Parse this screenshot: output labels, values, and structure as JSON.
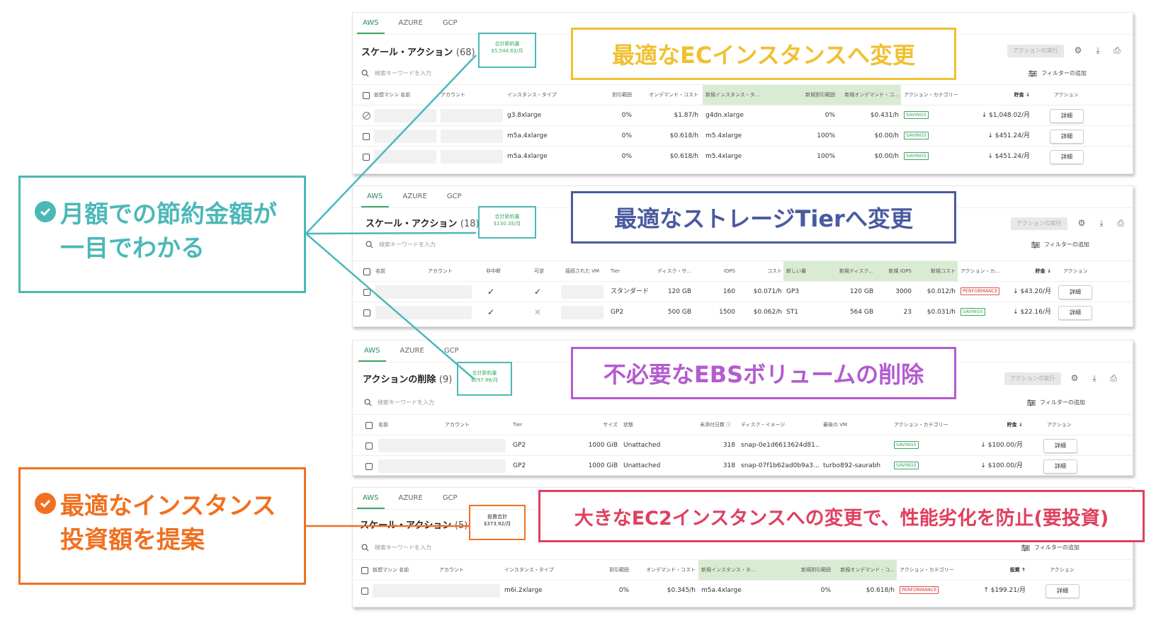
{
  "tab_labels": [
    "AWS",
    "AZURE",
    "GCP"
  ],
  "common": {
    "search_placeholder": "検索キーワードを入力",
    "filter_label": "フィルターの追加",
    "exec_label": "アクションの実行",
    "detail_label": "詳細",
    "savings_label": "SAVINGS",
    "performance_label": "PERFORMANCE"
  },
  "p1": {
    "title": "スケール・アクション",
    "count": "(68)",
    "sum_label": "合計節約量",
    "sum_value": "$5,544.63/月",
    "headers": [
      "仮想マシン 名前",
      "アカウント",
      "インスタンス・タイプ",
      "割引範囲",
      "オンデマンド・コスト",
      "新規インスタンス・タ...",
      "新規割引範囲",
      "新規オンデマンド・コ...",
      "アクション・カテゴリー",
      "貯金",
      "アクション"
    ],
    "rows": [
      {
        "type": "g3.8xlarge",
        "disc": "0%",
        "cost": "$1.87/h",
        "newtype": "g4dn.xlarge",
        "newdisc": "0%",
        "newcost": "$0.431/h",
        "saving": "↓ $1,048.02/月"
      },
      {
        "type": "m5a.4xlarge",
        "disc": "0%",
        "cost": "$0.618/h",
        "newtype": "m5.4xlarge",
        "newdisc": "100%",
        "newcost": "$0.00/h",
        "saving": "↓ $451.24/月"
      },
      {
        "type": "m5a.4xlarge",
        "disc": "0%",
        "cost": "$0.618/h",
        "newtype": "m5.4xlarge",
        "newdisc": "100%",
        "newcost": "$0.00/h",
        "saving": "↓ $451.24/月"
      }
    ],
    "banner": "最適なECインスタンスへ変更"
  },
  "p2": {
    "title": "スケール・アクション",
    "count": "(18)",
    "sum_label": "合計節約量",
    "sum_value": "$130.35/月",
    "headers": [
      "名前",
      "アカウント",
      "非中断",
      "可逆",
      "接続された VM",
      "Tier",
      "ディスク・サ...",
      "IOPS",
      "コスト",
      "新しい層",
      "新規ディスク...",
      "新規 IOPS",
      "新規コスト",
      "アクション・カ...",
      "貯金",
      "アクション"
    ],
    "rows": [
      {
        "tier": "スタンダード",
        "disk": "120 GB",
        "iops": "160",
        "cost": "$0.071/h",
        "newtier": "GP3",
        "newdisk": "120 GB",
        "newiops": "3000",
        "newcost": "$0.012/h",
        "saving": "↓ $43.20/月"
      },
      {
        "tier": "GP2",
        "disk": "500 GB",
        "iops": "1500",
        "cost": "$0.062/h",
        "newtier": "ST1",
        "newdisk": "564 GB",
        "newiops": "23",
        "newcost": "$0.031/h",
        "saving": "↓ $22.16/月"
      }
    ],
    "banner": "最適なストレージTierへ変更"
  },
  "p3": {
    "title": "アクションの削除",
    "count": "(9)",
    "sum_label": "合計節約量",
    "sum_value": "$297.98/月",
    "headers": [
      "名前",
      "アカウント",
      "Tier",
      "サイズ",
      "状態",
      "未添付日数",
      "ディスク・イメージ",
      "最後の VM",
      "アクション・カテゴリー",
      "貯金",
      "アクション"
    ],
    "rows": [
      {
        "tier": "GP2",
        "size": "1000 GiB",
        "state": "Unattached",
        "days": "318",
        "image": "snap-0e1d6613624d81…",
        "lastvm": "",
        "saving": "↓ $100.00/月"
      },
      {
        "tier": "GP2",
        "size": "1000 GiB",
        "state": "Unattached",
        "days": "318",
        "image": "snap-07f1b62ad0b9a3…",
        "lastvm": "turbo892-saurabh",
        "saving": "↓ $100.00/月"
      }
    ],
    "banner": "不必要なEBSボリュームの削除"
  },
  "p4": {
    "title": "スケール・アクション",
    "count": "(5)",
    "sum_label": "投資合計",
    "sum_value": "$373.92/月",
    "headers": [
      "仮想マシン 名前",
      "アカウント",
      "インスタンス・タイプ",
      "割引範囲",
      "オンデマンド・コスト",
      "新規インスタンス・タ...",
      "新規割引範囲",
      "新規オンデマンド・コ...",
      "アクション・カテゴリー",
      "投資",
      "アクション"
    ],
    "rows": [
      {
        "type": "m6i.2xlarge",
        "disc": "0%",
        "cost": "$0.345/h",
        "newtype": "m5a.4xlarge",
        "newdisc": "0%",
        "newcost": "$0.618/h",
        "saving": "↑ $199.21/月"
      }
    ],
    "banner": "大きなEC2インスタンスへの変更で、性能劣化を防止(要投資)"
  },
  "callout_teal": {
    "line1": "月額での節約金額が",
    "line2": "一目でわかる"
  },
  "callout_orange": {
    "line1": "最適なインスタンス",
    "line2": "投資額を提案"
  },
  "colors": {
    "teal": "#4bb8b8",
    "orange": "#f07020",
    "yellow": "#f0c030",
    "navy": "#4a5aa0",
    "purple": "#b45bd0",
    "red": "#e04060",
    "green": "#3aa760"
  }
}
